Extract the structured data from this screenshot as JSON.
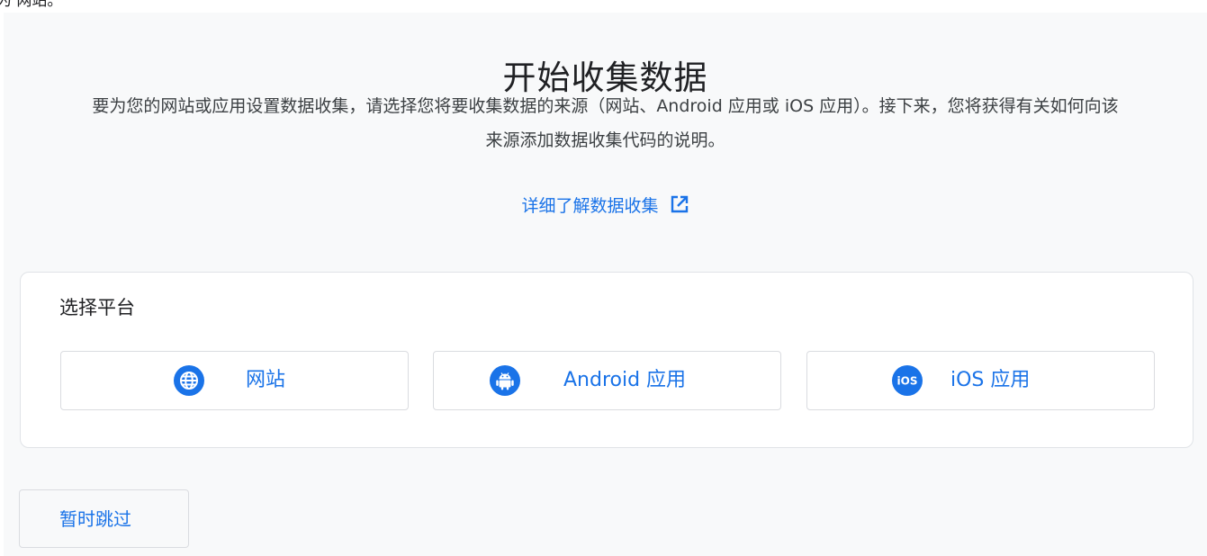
{
  "caption_fragment": "为 网站。",
  "page": {
    "title": "开始收集数据",
    "description": "要为您的网站或应用设置数据收集，请选择您将要收集数据的来源（网站、Android 应用或 iOS 应用）。接下来，您将获得有关如何向该来源添加数据收集代码的说明。",
    "learn_more_label": "详细了解数据收集"
  },
  "platform_card": {
    "title": "选择平台",
    "options": [
      {
        "label": "网站",
        "icon": "globe-icon"
      },
      {
        "label": "Android 应用",
        "icon": "android-icon"
      },
      {
        "label": "iOS 应用",
        "icon": "ios-icon"
      }
    ]
  },
  "footer": {
    "skip_label": "暂时跳过"
  },
  "colors": {
    "accent": "#1a73e8",
    "background": "#f8f9fa",
    "card": "#ffffff",
    "border": "#dadce0",
    "text": "#202124"
  }
}
